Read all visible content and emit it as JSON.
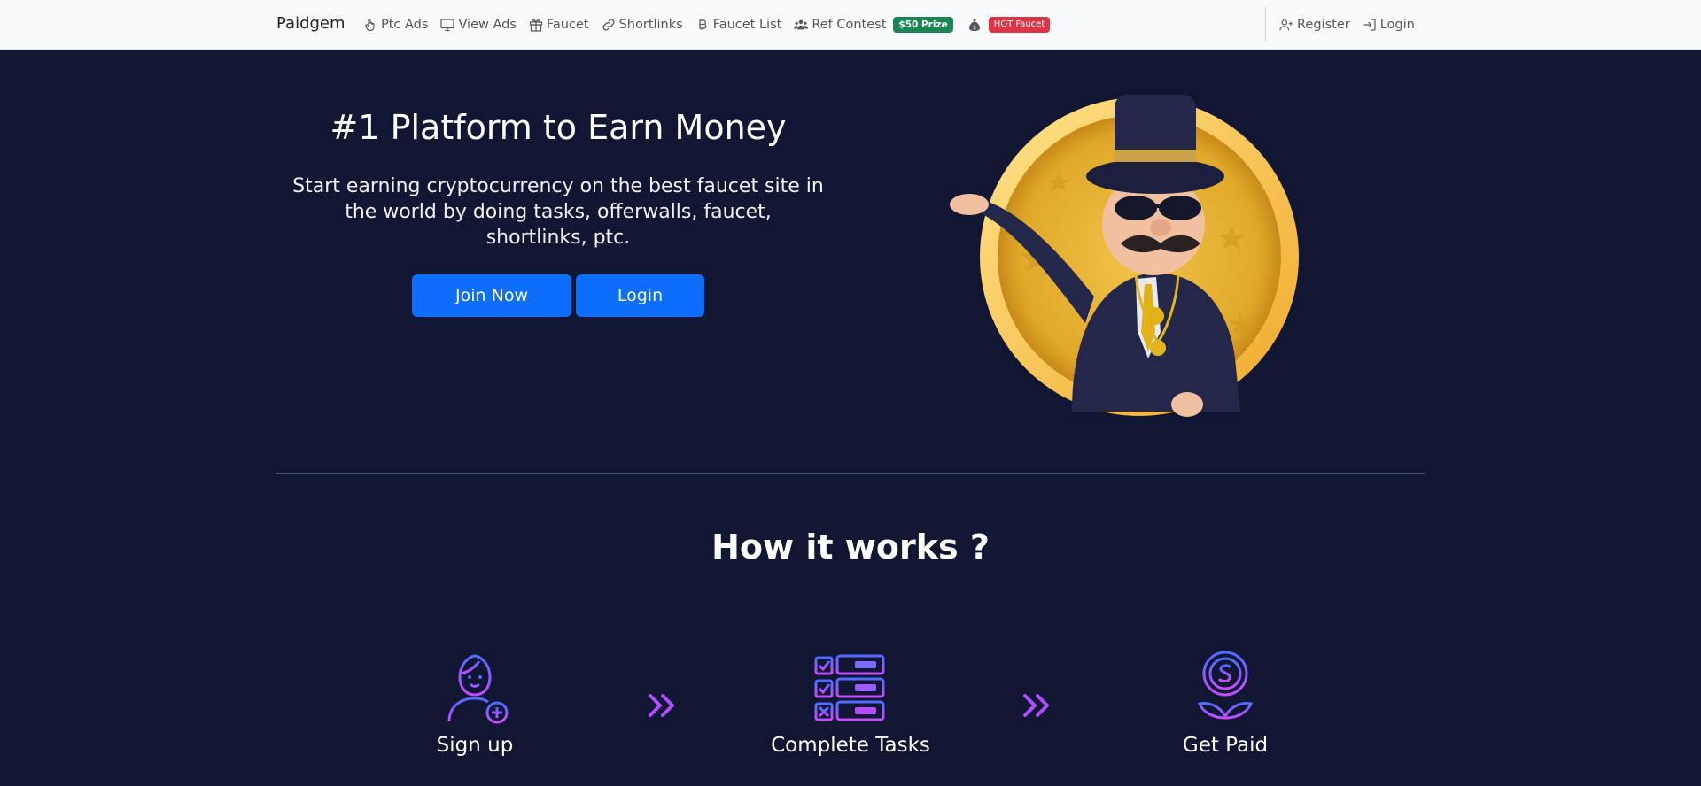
{
  "nav": {
    "brand": "Paidgem",
    "items": [
      {
        "label": "Ptc Ads",
        "icon": "hand-pointer-icon"
      },
      {
        "label": "View Ads",
        "icon": "monitor-icon"
      },
      {
        "label": "Faucet",
        "icon": "gift-icon"
      },
      {
        "label": "Shortlinks",
        "icon": "link-icon"
      },
      {
        "label": "Faucet List",
        "icon": "bitcoin-icon"
      },
      {
        "label": "Ref Contest",
        "icon": "users-icon"
      }
    ],
    "ref_contest_badge": "$50 Prize",
    "hot_faucet_badge": "HOT Faucet",
    "register": "Register",
    "login": "Login"
  },
  "hero": {
    "title": "#1 Platform to Earn Money",
    "subtitle": "Start earning cryptocurrency on the best faucet site in the world by doing tasks, offerwalls, faucet, shortlinks, ptc.",
    "join_button": "Join Now",
    "login_button": "Login"
  },
  "how_it_works": {
    "title": "How it works ?",
    "steps": [
      {
        "label": "Sign up",
        "icon": "user-plus-icon"
      },
      {
        "label": "Complete Tasks",
        "icon": "task-list-icon"
      },
      {
        "label": "Get Paid",
        "icon": "dollar-coin-plant-icon"
      }
    ]
  },
  "colors": {
    "background": "#111633",
    "navbar": "#f8f9fa",
    "primary_button": "#0d6efd",
    "badge_green": "#198754",
    "badge_red": "#dc3545",
    "icon_gradient_start": "#4f6bff",
    "icon_gradient_end": "#c44dff"
  }
}
